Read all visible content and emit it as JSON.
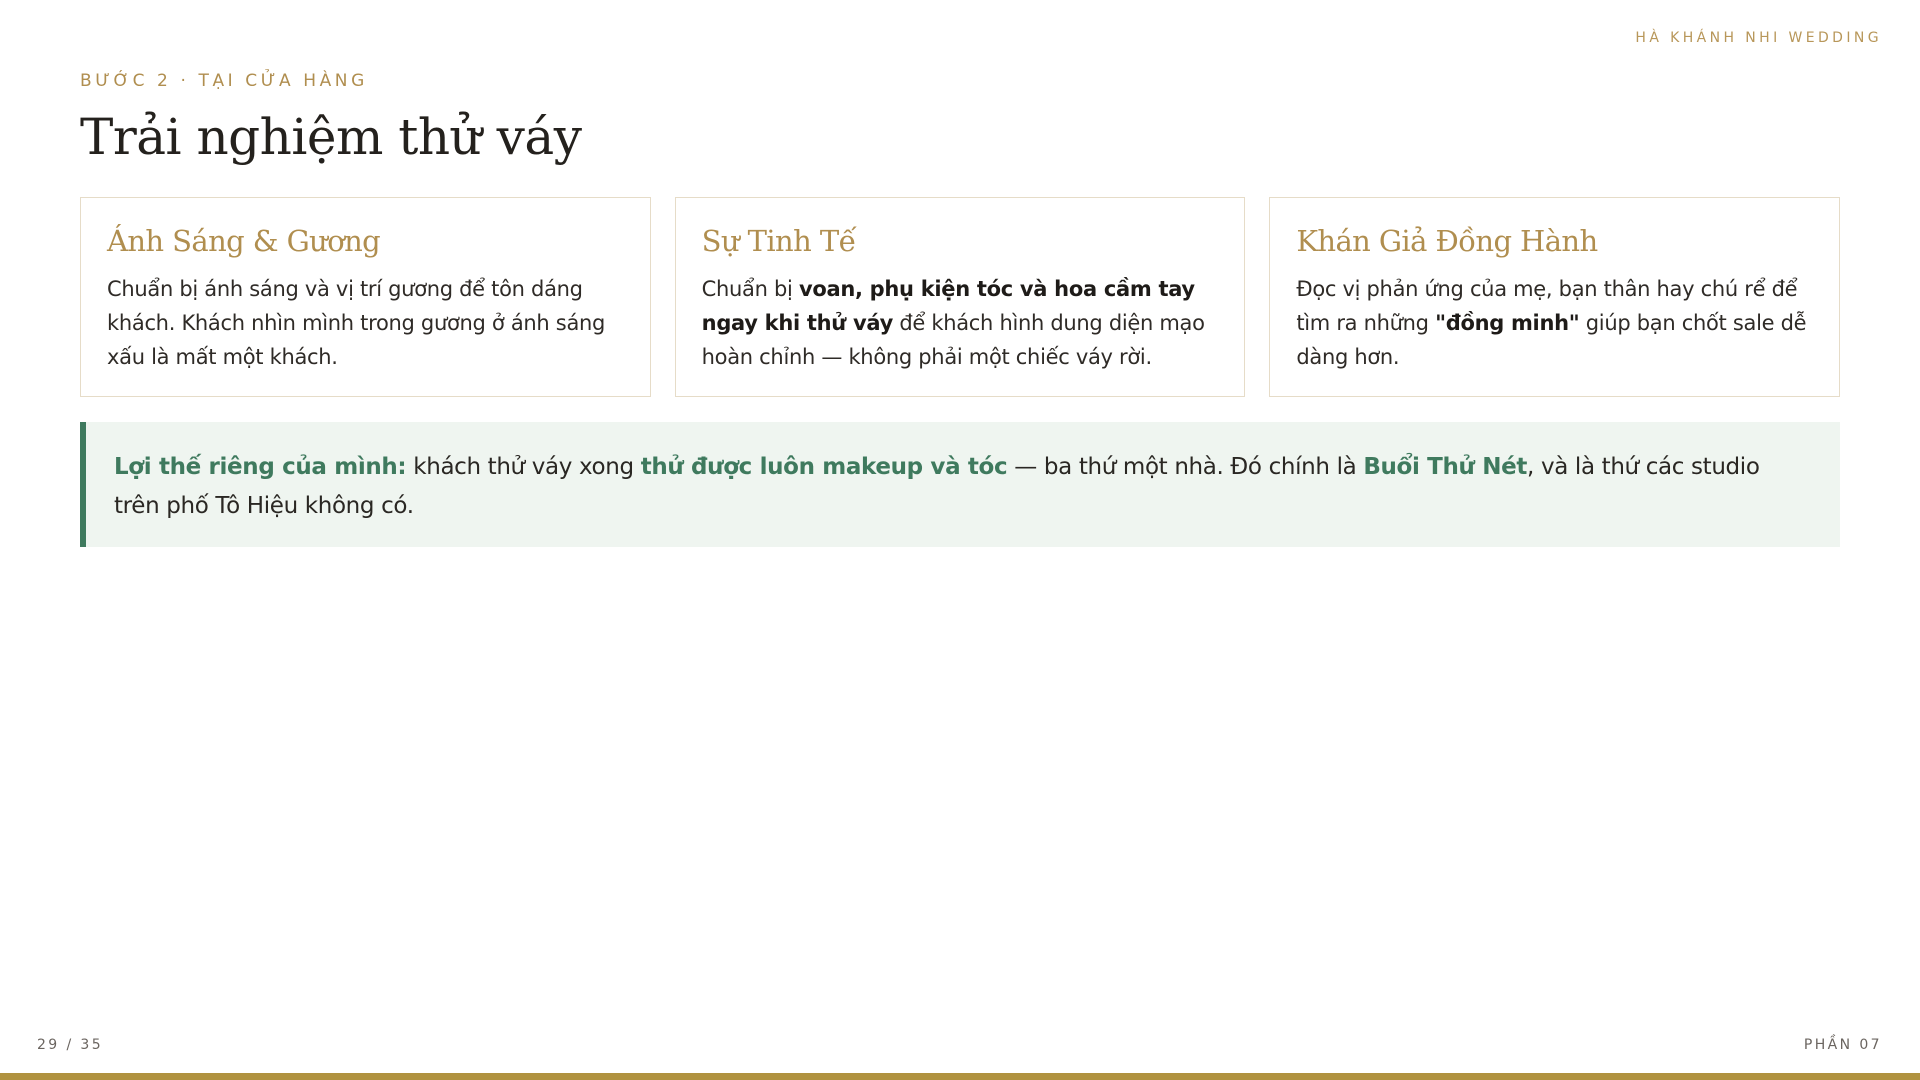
{
  "header": {
    "brand": "HÀ KHÁNH NHI WEDDING",
    "eyebrow": "BƯỚC 2 · TẠI CỬA HÀNG",
    "title": "Trải nghiệm thử váy"
  },
  "cards": [
    {
      "title": "Ánh Sáng & Gương",
      "parts": [
        "Chuẩn bị ánh sáng và vị trí gương để tôn dáng khách. Khách nhìn mình trong gương ở ánh sáng xấu là mất một khách."
      ]
    },
    {
      "title": "Sự Tinh Tế",
      "parts": [
        "Chuẩn bị ",
        "voan, phụ kiện tóc và hoa cầm tay ngay khi thử váy",
        " để khách hình dung diện mạo hoàn chỉnh — không phải một chiếc váy rời."
      ]
    },
    {
      "title": "Khán Giả Đồng Hành",
      "parts": [
        "Đọc vị phản ứng của mẹ, bạn thân hay chú rể để tìm ra những ",
        "\"đồng minh\"",
        " giúp bạn chốt sale dễ dàng hơn."
      ]
    }
  ],
  "callout": {
    "lead": "Lợi thế riêng của mình:",
    "t1": " khách thử váy xong ",
    "hl1": "thử được luôn makeup và tóc",
    "t2": " — ba thứ một nhà. Đó chính là ",
    "hl2": "Buổi Thử Nét",
    "t3": ", và là thứ các studio trên phố Tô Hiệu không có."
  },
  "footer": {
    "page": "29 / 35",
    "section": "PHẦN 07"
  },
  "colors": {
    "gold": "#b08e4f",
    "green": "#3f7a5e",
    "callout_bg": "#eff5f0",
    "bar": "#b0923f"
  }
}
